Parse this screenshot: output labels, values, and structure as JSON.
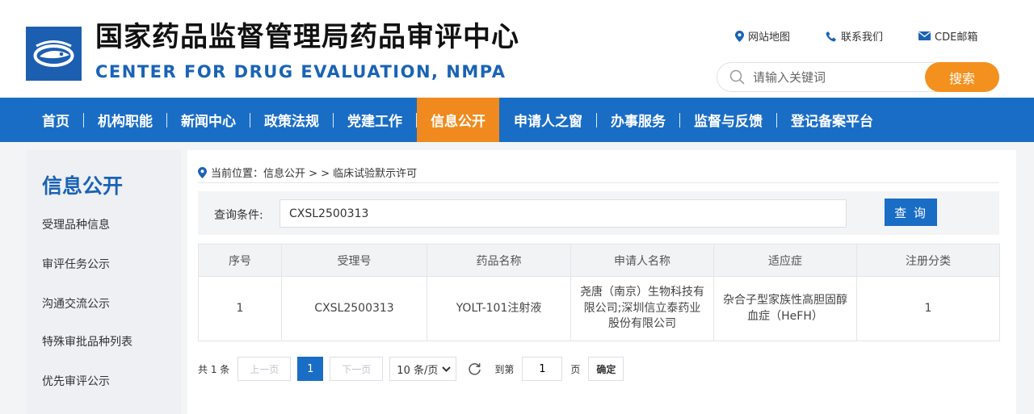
{
  "header": {
    "title_cn": "国家药品监督管理局药品审评中心",
    "title_en": "CENTER FOR DRUG EVALUATION, NMPA",
    "top_links": [
      {
        "label": "网站地图",
        "icon": "location-pin-icon"
      },
      {
        "label": "联系我们",
        "icon": "phone-icon"
      },
      {
        "label": "CDE邮箱",
        "icon": "mail-icon"
      }
    ],
    "search": {
      "placeholder": "请输入关键词",
      "button_label": "搜索"
    }
  },
  "nav": {
    "items": [
      "首页",
      "机构职能",
      "新闻中心",
      "政策法规",
      "党建工作",
      "信息公开",
      "申请人之窗",
      "办事服务",
      "监督与反馈",
      "登记备案平台"
    ],
    "active": "信息公开"
  },
  "sidebar": {
    "title": "信息公开",
    "items": [
      "受理品种信息",
      "审评任务公示",
      "沟通交流公示",
      "特殊审批品种列表",
      "优先审评公示"
    ]
  },
  "breadcrumb": "当前位置：信息公开 > > 临床试验默示许可",
  "query": {
    "label": "查询条件:",
    "value": "CXSL2500313",
    "button_label": "查 询"
  },
  "table": {
    "headers": [
      "序号",
      "受理号",
      "药品名称",
      "申请人名称",
      "适应症",
      "注册分类"
    ],
    "rows": [
      [
        "1",
        "CXSL2500313",
        "YOLT-101注射液",
        "尧唐（南京）生物科技有限公司;深圳信立泰药业股份有限公司",
        "杂合子型家族性高胆固醇血症（HeFH）",
        "1"
      ]
    ]
  },
  "pagination": {
    "total": "共 1 条",
    "prev": "上一页",
    "current": "1",
    "next": "下一页",
    "page_size": "10 条/页",
    "goto_label": "到第",
    "goto_value": "1",
    "page_suffix": "页",
    "confirm": "确定"
  },
  "colors": {
    "primary_blue": "#1a6dc5",
    "accent_orange": "#f08a1e",
    "search_orange": "#f4901e"
  }
}
